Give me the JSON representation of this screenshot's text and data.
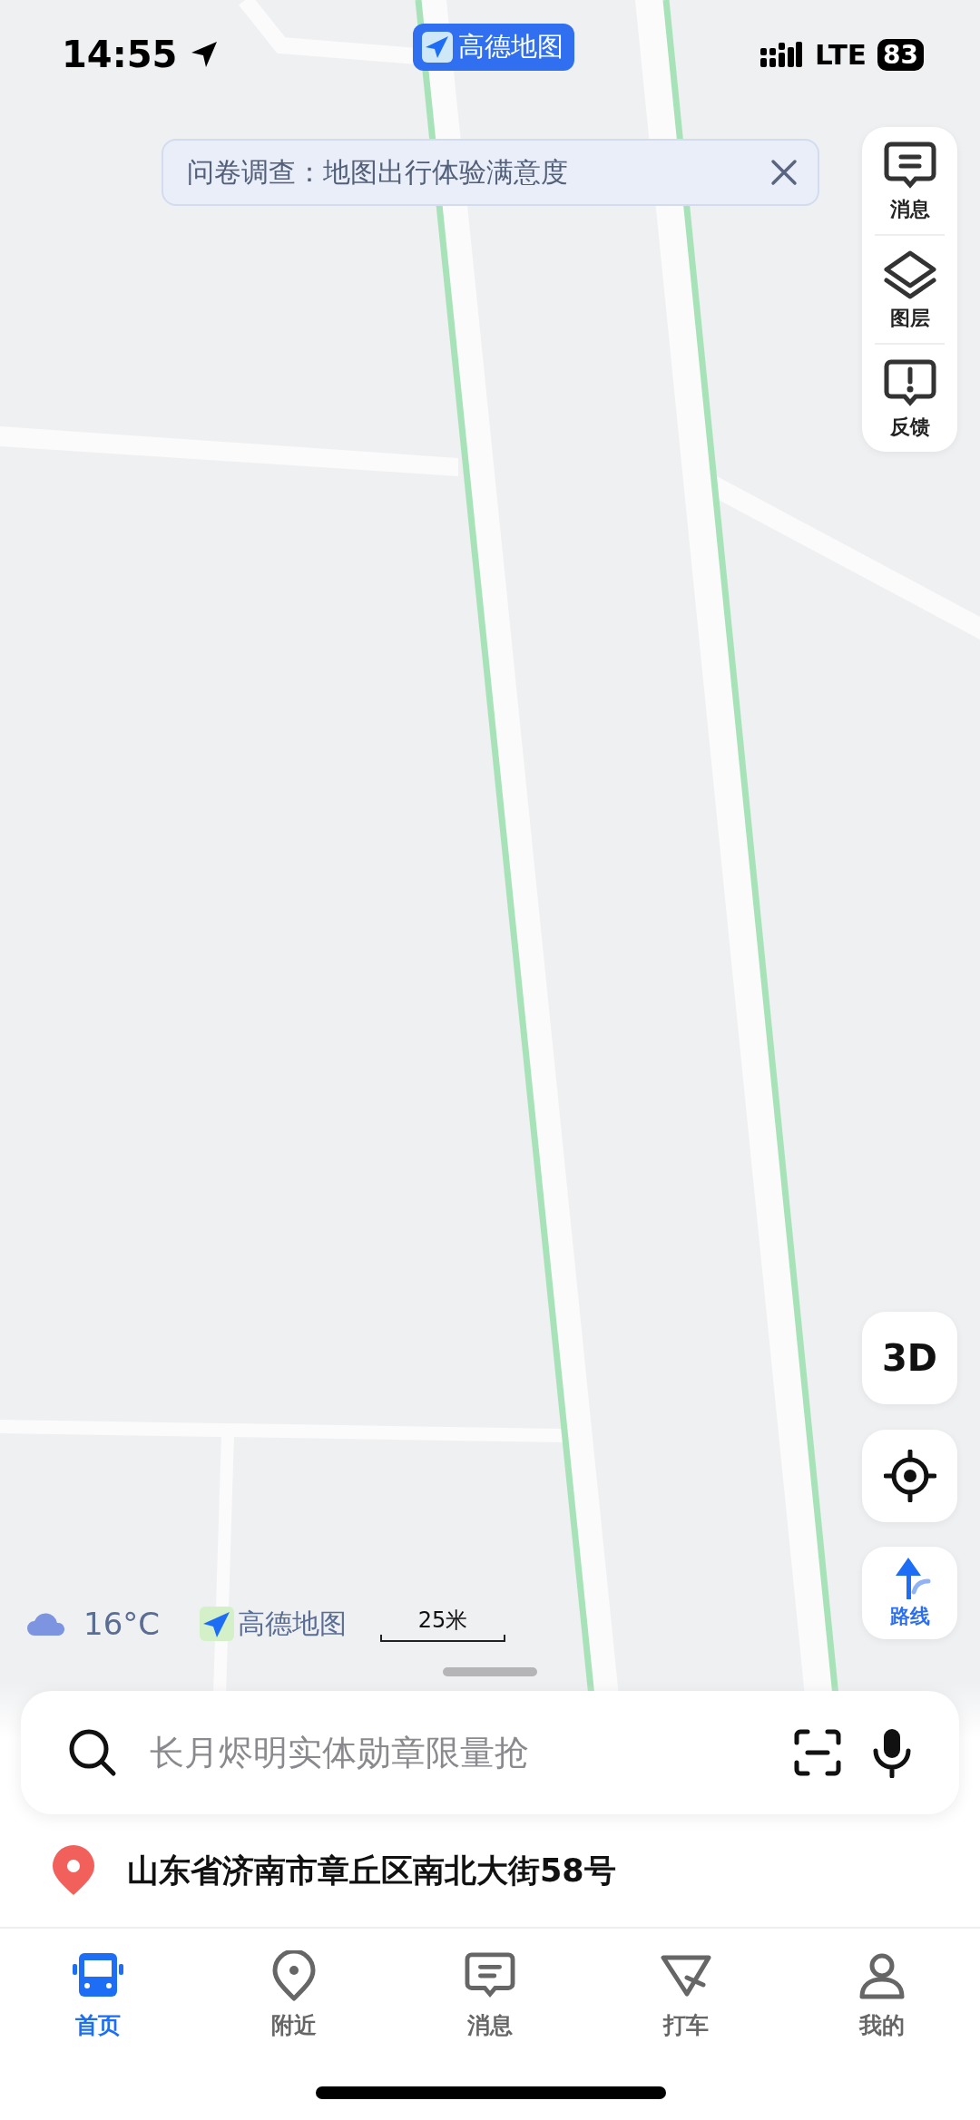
{
  "status_bar": {
    "time": "14:55",
    "network": "LTE",
    "battery": "83"
  },
  "app_badge": {
    "label": "高德地图"
  },
  "survey_banner": {
    "text": "问卷调查：地图出行体验满意度"
  },
  "map_tools": [
    {
      "label": "消息"
    },
    {
      "label": "图层"
    },
    {
      "label": "反馈"
    }
  ],
  "view_mode_button": {
    "label": "3D"
  },
  "route_button": {
    "label": "路线"
  },
  "weather": {
    "temperature": "16°C"
  },
  "map_logo": {
    "label": "高德地图"
  },
  "scale": {
    "label": "25米"
  },
  "search": {
    "placeholder": "长月烬明实体勋章限量抢"
  },
  "current_address": {
    "text": "山东省济南市章丘区南北大街58号"
  },
  "tabs": [
    {
      "label": "首页",
      "selected": true
    },
    {
      "label": "附近",
      "selected": false
    },
    {
      "label": "消息",
      "selected": false
    },
    {
      "label": "打车",
      "selected": false
    },
    {
      "label": "我的",
      "selected": false
    }
  ]
}
